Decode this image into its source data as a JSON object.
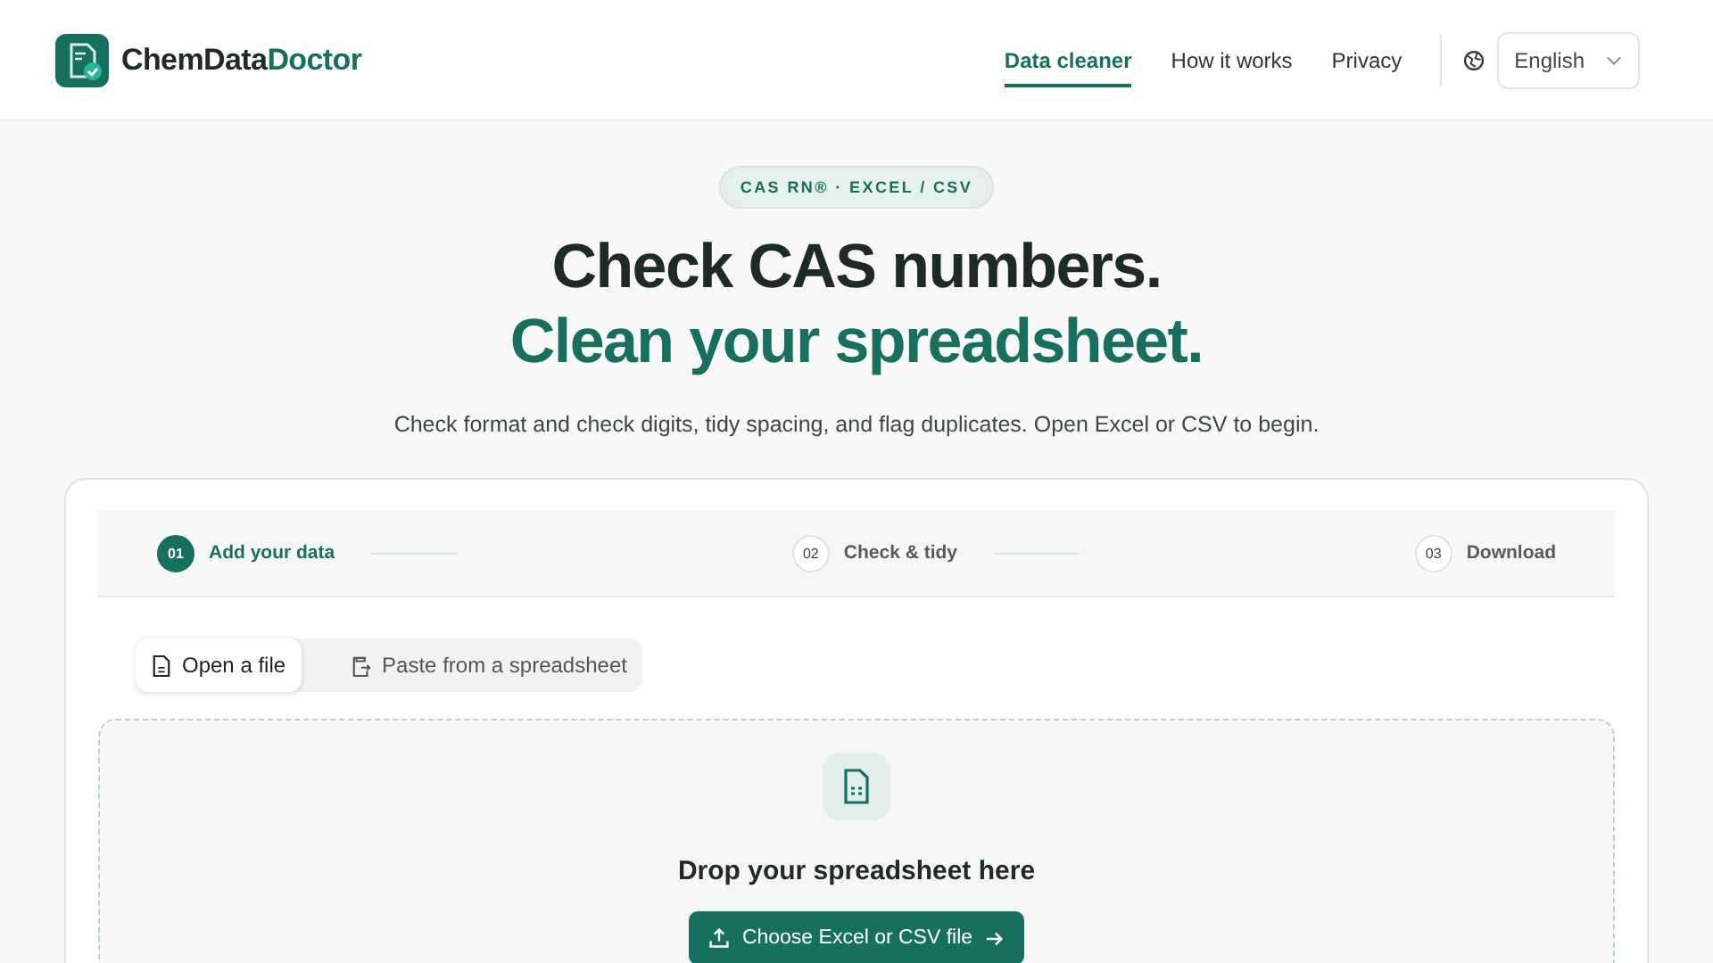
{
  "brand": {
    "name_part_1": "ChemData",
    "name_part_2": "Doctor"
  },
  "nav": [
    {
      "label": "Data cleaner",
      "selected": true
    },
    {
      "label": "How it works",
      "selected": false
    },
    {
      "label": "Privacy",
      "selected": false
    }
  ],
  "language": {
    "value": "English"
  },
  "hero": {
    "badge": "CAS RN® · EXCEL / CSV",
    "title_line_1": "Check CAS numbers.",
    "title_line_2": "Clean your spreadsheet.",
    "subtitle": "Check format and check digits, tidy spacing, and flag duplicates. Open Excel or CSV to begin."
  },
  "steps": [
    {
      "number": "01",
      "label": "Add your data",
      "selected": true
    },
    {
      "number": "02",
      "label": "Check & tidy",
      "selected": false
    },
    {
      "number": "03",
      "label": "Download",
      "selected": false
    }
  ],
  "input_tabs": [
    {
      "kind": "file",
      "label": "Open a file",
      "selected": true
    },
    {
      "kind": "paste",
      "label": "Paste from a spreadsheet",
      "selected": false
    }
  ],
  "dropzone": {
    "title": "Drop your spreadsheet here",
    "button": "Choose Excel or CSV file"
  }
}
